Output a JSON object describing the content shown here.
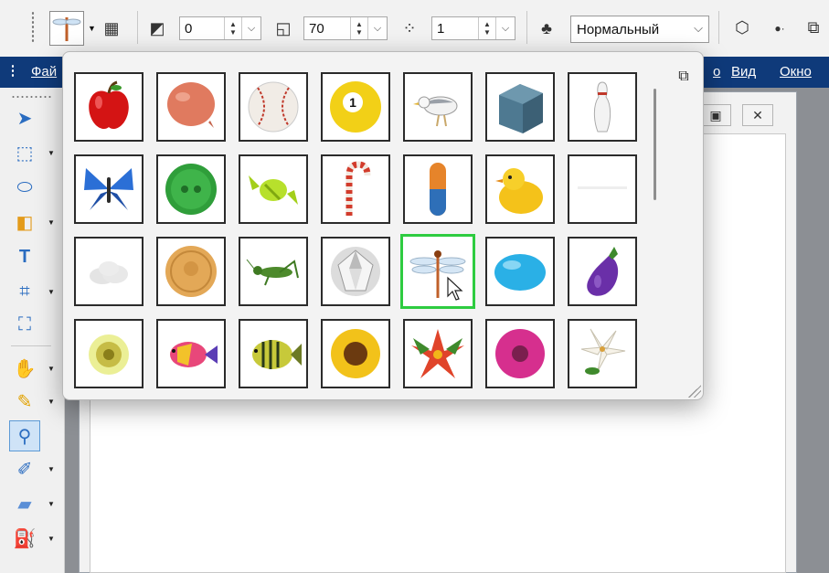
{
  "toolbar": {
    "opacity_value": "0",
    "size_value": "70",
    "density_value": "1",
    "blend_mode": "Нормальный"
  },
  "menubar": {
    "items": [
      "Фай",
      "о",
      "Вид",
      "Окно"
    ]
  },
  "picker": {
    "tubes": [
      "apple",
      "balloon",
      "baseball",
      "billiard-ball-1",
      "seagull",
      "cube",
      "bowling-pin",
      "butterfly",
      "button",
      "candy",
      "candy-cane",
      "pill",
      "chick",
      "blank-white",
      "cloud",
      "coin",
      "grasshopper",
      "diamond",
      "dragonfly",
      "blue-egg",
      "eggplant",
      "fireworks",
      "tropical-fish",
      "striped-fish",
      "sunflower",
      "red-flower",
      "pink-flower",
      "lily"
    ],
    "selected": "dragonfly"
  },
  "colors": {
    "menubar_bg": "#0f3a7a",
    "selection_border": "#2ecc40"
  }
}
